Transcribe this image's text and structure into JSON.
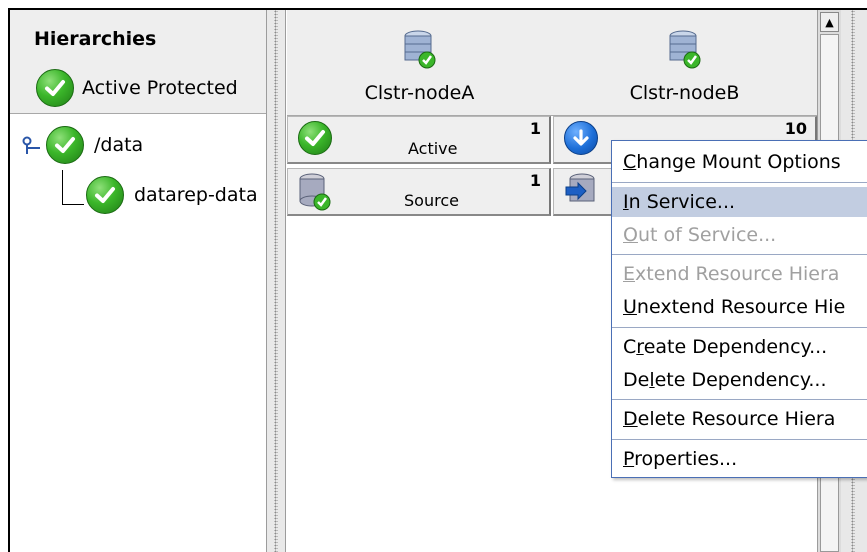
{
  "left_panel": {
    "title": "Hierarchies",
    "status_label": "Active Protected",
    "tree": [
      {
        "label": "/data"
      },
      {
        "label": "datarep-data"
      }
    ]
  },
  "nodes": [
    {
      "name": "Clstr-nodeA"
    },
    {
      "name": "Clstr-nodeB"
    }
  ],
  "cells": [
    {
      "node": "Clstr-nodeA",
      "state": "Active",
      "priority": "1",
      "icon": "check-icon"
    },
    {
      "node": "Clstr-nodeA",
      "state": "Source",
      "priority": "1",
      "icon": "database-icon"
    },
    {
      "node": "Clstr-nodeB",
      "state": "",
      "priority": "10",
      "icon": "standby-arrow-icon"
    },
    {
      "node": "Clstr-nodeB",
      "state": "",
      "priority": "",
      "icon": "database-target-icon"
    }
  ],
  "context_menu": {
    "items": [
      {
        "pre": "",
        "key": "C",
        "post": "hange Mount Options",
        "enabled": true,
        "highlighted": false
      },
      {
        "pre": "",
        "key": "I",
        "post": "n Service...",
        "enabled": true,
        "highlighted": true
      },
      {
        "pre": "",
        "key": "O",
        "post": "ut of Service...",
        "enabled": false,
        "highlighted": false
      },
      {
        "pre": "",
        "key": "E",
        "post": "xtend Resource Hiera",
        "enabled": false,
        "highlighted": false
      },
      {
        "pre": "",
        "key": "U",
        "post": "nextend Resource Hie",
        "enabled": true,
        "highlighted": false
      },
      {
        "pre": "C",
        "key": "r",
        "post": "eate Dependency...",
        "enabled": true,
        "highlighted": false
      },
      {
        "pre": "De",
        "key": "l",
        "post": "ete Dependency...",
        "enabled": true,
        "highlighted": false
      },
      {
        "pre": "",
        "key": "D",
        "post": "elete Resource Hiera",
        "enabled": true,
        "highlighted": false
      },
      {
        "pre": "",
        "key": "P",
        "post": "roperties...",
        "enabled": true,
        "highlighted": false
      }
    ]
  },
  "colors": {
    "check_green": "#3bb62a",
    "menu_highlight": "#c2cde1",
    "menu_border": "#4a6fb5",
    "header_bg": "#eeeeee"
  }
}
